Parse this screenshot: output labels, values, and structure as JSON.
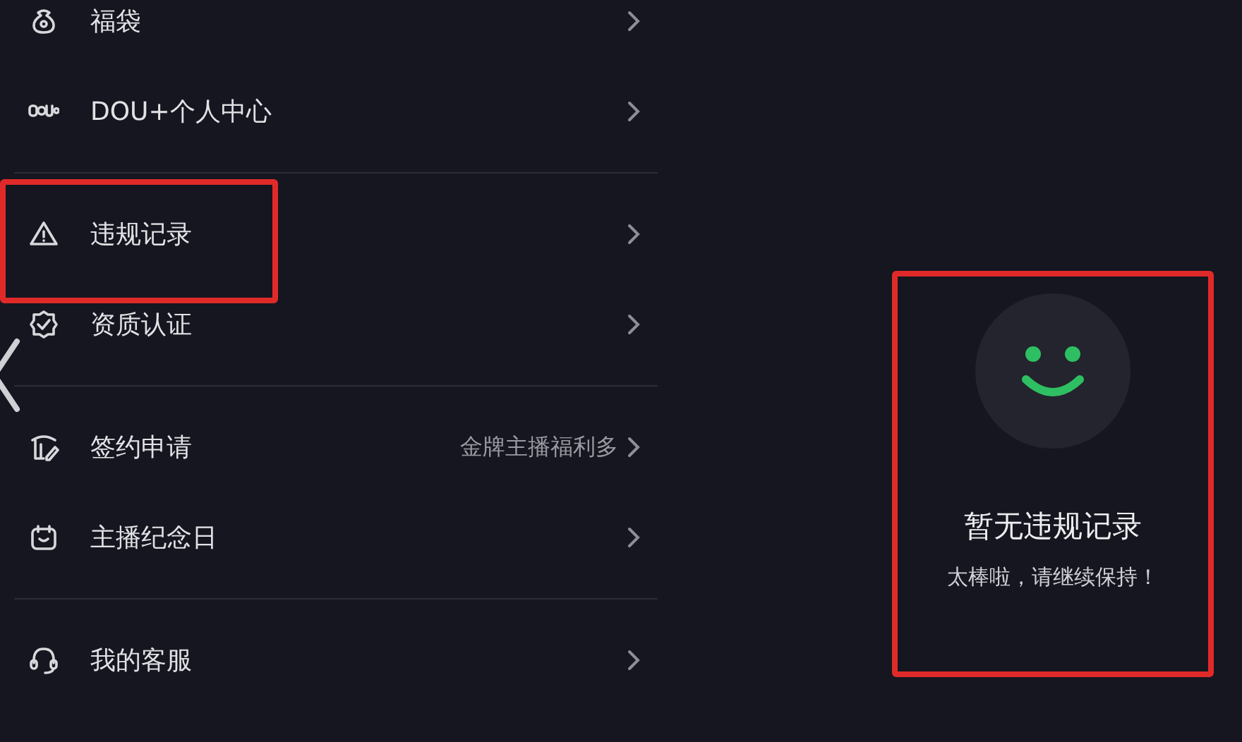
{
  "menu_groups": [
    {
      "items": [
        {
          "kind": "bag",
          "label": "福袋",
          "annotated": false
        },
        {
          "kind": "logo",
          "label": "DOU+个人中心",
          "annotated": false
        }
      ]
    },
    {
      "items": [
        {
          "kind": "warning",
          "label": "违规记录",
          "annotated": true
        },
        {
          "kind": "badge",
          "label": "资质认证",
          "annotated": false
        }
      ]
    },
    {
      "items": [
        {
          "kind": "contract",
          "label": "签约申请",
          "hint": "金牌主播福利多",
          "annotated": false
        },
        {
          "kind": "calendar",
          "label": "主播纪念日",
          "annotated": false
        }
      ]
    },
    {
      "items": [
        {
          "kind": "headset",
          "label": "我的客服",
          "annotated": false
        }
      ]
    }
  ],
  "empty_state": {
    "title": "暂无违规记录",
    "message": "太棒啦，请继续保持！",
    "annotated": true
  }
}
